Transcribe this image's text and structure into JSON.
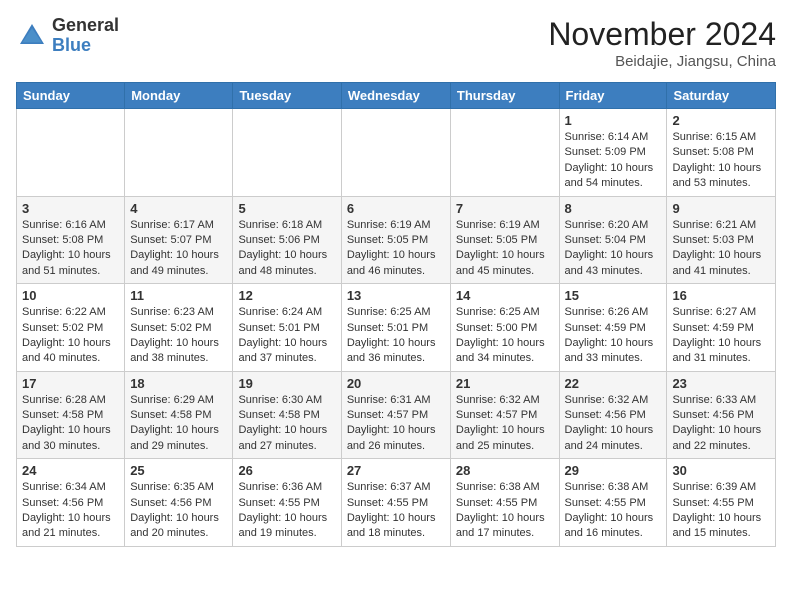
{
  "header": {
    "logo_general": "General",
    "logo_blue": "Blue",
    "month_title": "November 2024",
    "location": "Beidajie, Jiangsu, China"
  },
  "weekdays": [
    "Sunday",
    "Monday",
    "Tuesday",
    "Wednesday",
    "Thursday",
    "Friday",
    "Saturday"
  ],
  "weeks": [
    [
      null,
      null,
      null,
      null,
      null,
      {
        "day": "1",
        "sunrise": "6:14 AM",
        "sunset": "5:09 PM",
        "daylight": "10 hours and 54 minutes."
      },
      {
        "day": "2",
        "sunrise": "6:15 AM",
        "sunset": "5:08 PM",
        "daylight": "10 hours and 53 minutes."
      }
    ],
    [
      {
        "day": "3",
        "sunrise": "6:16 AM",
        "sunset": "5:08 PM",
        "daylight": "10 hours and 51 minutes."
      },
      {
        "day": "4",
        "sunrise": "6:17 AM",
        "sunset": "5:07 PM",
        "daylight": "10 hours and 49 minutes."
      },
      {
        "day": "5",
        "sunrise": "6:18 AM",
        "sunset": "5:06 PM",
        "daylight": "10 hours and 48 minutes."
      },
      {
        "day": "6",
        "sunrise": "6:19 AM",
        "sunset": "5:05 PM",
        "daylight": "10 hours and 46 minutes."
      },
      {
        "day": "7",
        "sunrise": "6:19 AM",
        "sunset": "5:05 PM",
        "daylight": "10 hours and 45 minutes."
      },
      {
        "day": "8",
        "sunrise": "6:20 AM",
        "sunset": "5:04 PM",
        "daylight": "10 hours and 43 minutes."
      },
      {
        "day": "9",
        "sunrise": "6:21 AM",
        "sunset": "5:03 PM",
        "daylight": "10 hours and 41 minutes."
      }
    ],
    [
      {
        "day": "10",
        "sunrise": "6:22 AM",
        "sunset": "5:02 PM",
        "daylight": "10 hours and 40 minutes."
      },
      {
        "day": "11",
        "sunrise": "6:23 AM",
        "sunset": "5:02 PM",
        "daylight": "10 hours and 38 minutes."
      },
      {
        "day": "12",
        "sunrise": "6:24 AM",
        "sunset": "5:01 PM",
        "daylight": "10 hours and 37 minutes."
      },
      {
        "day": "13",
        "sunrise": "6:25 AM",
        "sunset": "5:01 PM",
        "daylight": "10 hours and 36 minutes."
      },
      {
        "day": "14",
        "sunrise": "6:25 AM",
        "sunset": "5:00 PM",
        "daylight": "10 hours and 34 minutes."
      },
      {
        "day": "15",
        "sunrise": "6:26 AM",
        "sunset": "4:59 PM",
        "daylight": "10 hours and 33 minutes."
      },
      {
        "day": "16",
        "sunrise": "6:27 AM",
        "sunset": "4:59 PM",
        "daylight": "10 hours and 31 minutes."
      }
    ],
    [
      {
        "day": "17",
        "sunrise": "6:28 AM",
        "sunset": "4:58 PM",
        "daylight": "10 hours and 30 minutes."
      },
      {
        "day": "18",
        "sunrise": "6:29 AM",
        "sunset": "4:58 PM",
        "daylight": "10 hours and 29 minutes."
      },
      {
        "day": "19",
        "sunrise": "6:30 AM",
        "sunset": "4:58 PM",
        "daylight": "10 hours and 27 minutes."
      },
      {
        "day": "20",
        "sunrise": "6:31 AM",
        "sunset": "4:57 PM",
        "daylight": "10 hours and 26 minutes."
      },
      {
        "day": "21",
        "sunrise": "6:32 AM",
        "sunset": "4:57 PM",
        "daylight": "10 hours and 25 minutes."
      },
      {
        "day": "22",
        "sunrise": "6:32 AM",
        "sunset": "4:56 PM",
        "daylight": "10 hours and 24 minutes."
      },
      {
        "day": "23",
        "sunrise": "6:33 AM",
        "sunset": "4:56 PM",
        "daylight": "10 hours and 22 minutes."
      }
    ],
    [
      {
        "day": "24",
        "sunrise": "6:34 AM",
        "sunset": "4:56 PM",
        "daylight": "10 hours and 21 minutes."
      },
      {
        "day": "25",
        "sunrise": "6:35 AM",
        "sunset": "4:56 PM",
        "daylight": "10 hours and 20 minutes."
      },
      {
        "day": "26",
        "sunrise": "6:36 AM",
        "sunset": "4:55 PM",
        "daylight": "10 hours and 19 minutes."
      },
      {
        "day": "27",
        "sunrise": "6:37 AM",
        "sunset": "4:55 PM",
        "daylight": "10 hours and 18 minutes."
      },
      {
        "day": "28",
        "sunrise": "6:38 AM",
        "sunset": "4:55 PM",
        "daylight": "10 hours and 17 minutes."
      },
      {
        "day": "29",
        "sunrise": "6:38 AM",
        "sunset": "4:55 PM",
        "daylight": "10 hours and 16 minutes."
      },
      {
        "day": "30",
        "sunrise": "6:39 AM",
        "sunset": "4:55 PM",
        "daylight": "10 hours and 15 minutes."
      }
    ]
  ]
}
